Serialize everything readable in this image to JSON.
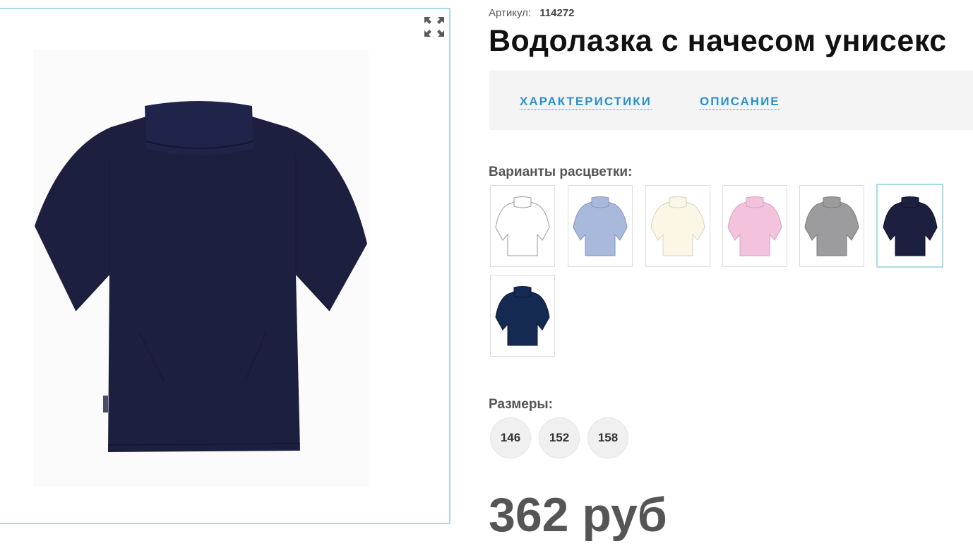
{
  "product": {
    "sku_label": "Артикул:",
    "sku_value": "114272",
    "title": "Водолазка с начесом унисекс",
    "main_image_color": "#1d1f3f"
  },
  "tabs": [
    {
      "label": "ХАРАКТЕРИСТИКИ"
    },
    {
      "label": "ОПИСАНИЕ"
    }
  ],
  "colors": {
    "label": "Варианты расцветки:",
    "variants": [
      {
        "color": "#ffffff",
        "stroke": "#9a9a9a",
        "selected": false
      },
      {
        "color": "#a9b9dc",
        "stroke": "#8595bf",
        "selected": false
      },
      {
        "color": "#fbf6e6",
        "stroke": "#d9d2bd",
        "selected": false
      },
      {
        "color": "#f3c3de",
        "stroke": "#d79fc0",
        "selected": false
      },
      {
        "color": "#9c9c9e",
        "stroke": "#7c7c80",
        "selected": false
      },
      {
        "color": "#1d1f3f",
        "stroke": "#111327",
        "selected": true
      },
      {
        "color": "#142a52",
        "stroke": "#0c1a36",
        "selected": false
      }
    ]
  },
  "sizes": {
    "label": "Размеры:",
    "options": [
      "146",
      "152",
      "158"
    ]
  },
  "price": {
    "text": "362 руб"
  },
  "icons": {
    "expand": "expand-arrows-icon"
  },
  "accent_colors": {
    "link_blue": "#2a8fcc",
    "frame_border": "#a9dbe5"
  }
}
